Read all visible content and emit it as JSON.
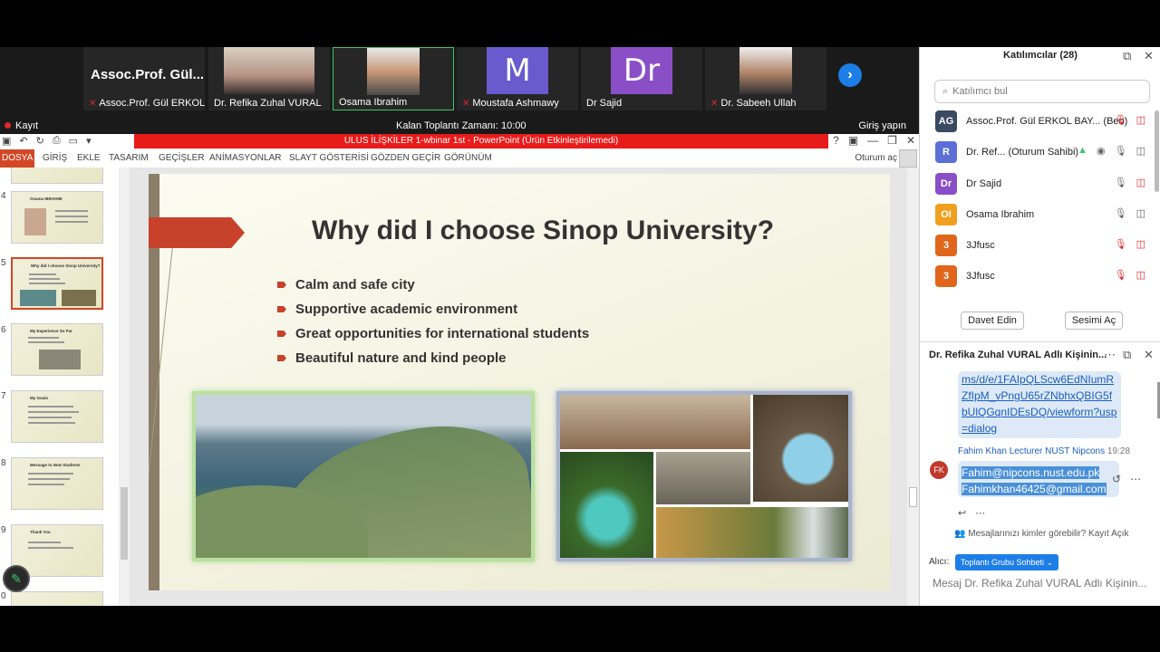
{
  "video_strip": {
    "tiles": [
      {
        "big": "Assoc.Prof.  Gül...",
        "name": "Assoc.Prof. Gül ERKOL ..."
      },
      {
        "name": "Dr. Refika Zuhal VURAL"
      },
      {
        "name": "Osama Ibrahim"
      },
      {
        "avatar": "M",
        "name": "Moustafa Ashmawy",
        "color": "#6a5acd"
      },
      {
        "avatar": "Dr",
        "name": "Dr Sajid",
        "color": "#8a4fc7"
      },
      {
        "name": "Dr. Sabeeh Ullah"
      }
    ],
    "next_icon": "chevron-right-icon"
  },
  "rec_bar": {
    "record": "Kayıt",
    "timer": "Kalan Toplantı Zamanı: 10:00",
    "signin": "Giriş yapın"
  },
  "ppt": {
    "title": "ULUS İLİŞKİLER 1-wbinar 1st -  PowerPoint (Ürün Etkinleştirilemedi)",
    "menu": [
      "DOSYA",
      "GİRİŞ",
      "EKLE",
      "TASARIM",
      "GEÇİŞLER",
      "ANİMASYONLAR",
      "SLAYT GÖSTERİSİ",
      "GÖZDEN GEÇİR",
      "GÖRÜNÜM"
    ],
    "user": "Oturum aç",
    "thumbs": [
      {
        "num": "4",
        "title": "Osama IBRAHIM"
      },
      {
        "num": "5",
        "title": "Why did I choose Sinop University?"
      },
      {
        "num": "6",
        "title": "My Experience So Far"
      },
      {
        "num": "7",
        "title": "My Goals"
      },
      {
        "num": "8",
        "title": "Message to New Students"
      },
      {
        "num": "9",
        "title": "Thank You"
      },
      {
        "num": "0",
        "title": ""
      }
    ],
    "slide": {
      "title": "Why did I choose Sinop University?",
      "bullets": [
        "Calm and safe city",
        "Supportive academic environment",
        "Great opportunities for international students",
        "Beautiful nature and kind people"
      ]
    }
  },
  "panel": {
    "title": "Katılımcılar (28)",
    "search_placeholder": "Katılımcı bul",
    "participants": [
      {
        "initials": "AG",
        "name": "Assoc.Prof. Gül ERKOL BAY... (Ben)",
        "color": "#3a4a63"
      },
      {
        "initials": "R",
        "name": "Dr. Ref... (Oturum Sahibi)",
        "color": "#5b6fd6"
      },
      {
        "initials": "Dr",
        "name": "Dr Sajid",
        "color": "#8a4fc7"
      },
      {
        "initials": "OI",
        "name": "Osama Ibrahim",
        "color": "#f0a01e"
      },
      {
        "initials": "3",
        "name": "3Jfusc",
        "color": "#e0661c"
      },
      {
        "initials": "3",
        "name": "3Jfusc",
        "color": "#e0661c"
      }
    ],
    "invite": "Davet Edin",
    "unmute": "Sesimi Aç",
    "chat": {
      "title": "Dr. Refika Zuhal VURAL Adlı Kişinin...",
      "link": "ms/d/e/1FAIpQLScw6EdNIumRZfIpM_vPngU65rZNbhxQBIG5fbUlQGqnIDEsDQ/viewform?usp=dialog",
      "author": "Fahim Khan Lecturer NUST Nipcons",
      "time": "19:28",
      "initials": "FK",
      "line1": "Fahim@nipcons.nust.edu.pk",
      "line2": "Fahimkhan46425@gmail.com",
      "visibility": "Mesajlarınızı kimler görebilir? Kayıt Açık",
      "to_label": "Alıcı:",
      "to_value": "Toplantı Grubu Sohbeti",
      "input_placeholder": "Mesaj Dr. Refika Zuhal VURAL Adlı Kişinin..."
    }
  }
}
